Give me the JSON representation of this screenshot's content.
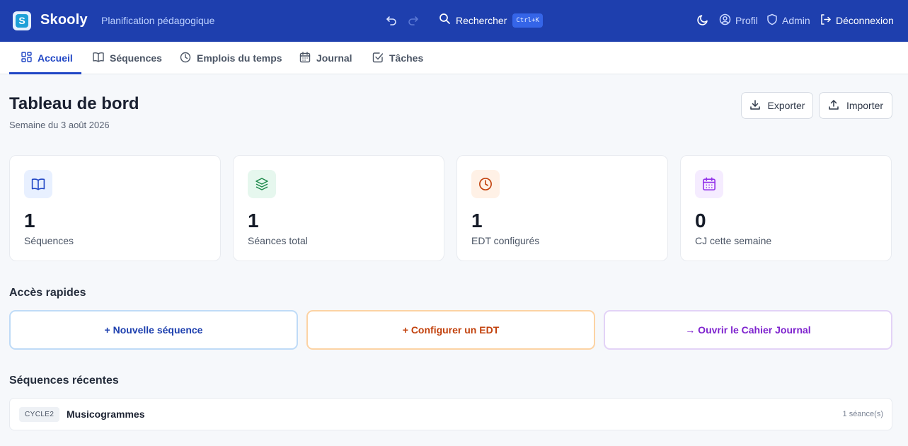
{
  "header": {
    "logo_letter": "S",
    "brand": "Skooly",
    "subtitle": "Planification pédagogique",
    "search_label": "Rechercher",
    "search_shortcut": "Ctrl+K",
    "profile_label": "Profil",
    "admin_label": "Admin",
    "logout_label": "Déconnexion"
  },
  "nav": {
    "tabs": [
      {
        "label": "Accueil",
        "icon": "dashboard-icon",
        "active": true
      },
      {
        "label": "Séquences",
        "icon": "book-icon"
      },
      {
        "label": "Emplois du temps",
        "icon": "clock-icon"
      },
      {
        "label": "Journal",
        "icon": "calendar-icon"
      },
      {
        "label": "Tâches",
        "icon": "checkbox-icon"
      }
    ]
  },
  "page": {
    "title": "Tableau de bord",
    "week": "Semaine du 3 août 2026",
    "export_label": "Exporter",
    "import_label": "Importer"
  },
  "stats": [
    {
      "value": "1",
      "label": "Séquences",
      "icon": "book-icon",
      "color": "#2046c5",
      "bg": "#e8f0ff"
    },
    {
      "value": "1",
      "label": "Séances total",
      "icon": "layers-icon",
      "color": "#1f8a4c",
      "bg": "#e6f7ee"
    },
    {
      "value": "1",
      "label": "EDT configurés",
      "icon": "clock-icon",
      "color": "#c2410c",
      "bg": "#fff1e6"
    },
    {
      "value": "0",
      "label": "CJ cette semaine",
      "icon": "calendar-icon",
      "color": "#9333ea",
      "bg": "#f5ecff"
    }
  ],
  "quick_access": {
    "title": "Accès rapides",
    "items": [
      {
        "label": "+ Nouvelle séquence",
        "color": "#1e40af",
        "border": "#bfdbf7"
      },
      {
        "label": "+ Configurer un EDT",
        "color": "#c2410c",
        "border": "#fcd3a4"
      },
      {
        "label": "→ Ouvrir le Cahier Journal",
        "color": "#7e22ce",
        "border": "#e3d3f7"
      }
    ]
  },
  "recent": {
    "title": "Séquences récentes",
    "items": [
      {
        "tag": "CYCLE2",
        "title": "Musicogrammes",
        "count": "1 séance(s)"
      }
    ]
  }
}
